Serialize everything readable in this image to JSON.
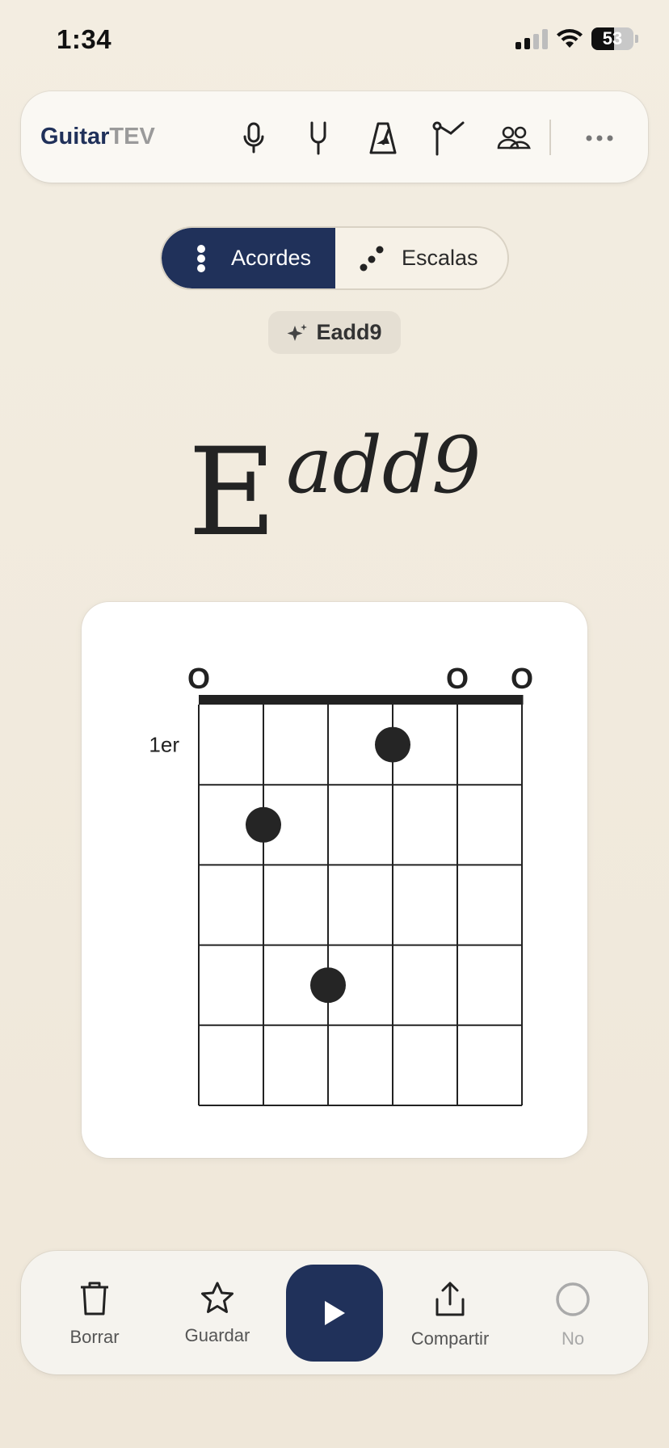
{
  "status": {
    "time": "1:34",
    "battery": "53"
  },
  "app": {
    "name_part1": "Guitar",
    "name_part2": "TEV"
  },
  "toolbar": {
    "icons": [
      "microphone-icon",
      "tuning-fork-icon",
      "metronome-icon",
      "flag-icon",
      "users-icon",
      "more-icon"
    ]
  },
  "mode_switch": {
    "chords_label": "Acordes",
    "scales_label": "Escalas",
    "selected": "Acordes"
  },
  "chord_chip": {
    "label": "Eadd9"
  },
  "chord": {
    "root": "E",
    "extension": "add9"
  },
  "diagram": {
    "position_label": "1er",
    "strings": 6,
    "frets": 5,
    "string_markers": [
      "O",
      "",
      "",
      "",
      "O",
      "O"
    ],
    "dots": [
      {
        "string": 4,
        "fret": 1
      },
      {
        "string": 2,
        "fret": 2
      },
      {
        "string": 3,
        "fret": 4
      }
    ]
  },
  "actions": {
    "delete_label": "Borrar",
    "save_label": "Guardar",
    "share_label": "Compartir",
    "no_label": "No"
  },
  "colors": {
    "accent": "#20315a",
    "background": "#f3ede1",
    "dot": "#252525"
  }
}
